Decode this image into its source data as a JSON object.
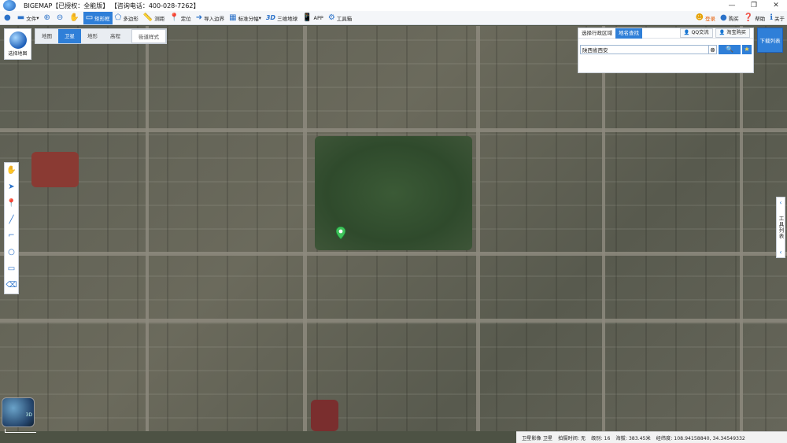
{
  "app": {
    "title": "BIGEMAP【已授权：全能版】 【咨询电话：400-028-7262】"
  },
  "window_controls": {
    "minimize": "—",
    "maximize": "❐",
    "close": "✕"
  },
  "toolbar": {
    "file": "文件",
    "rect_select": "矩形框",
    "polygon": "多边形",
    "measure": "测距",
    "locate": "定位",
    "import_boundary": "导入边界",
    "standard_tile": "标准分幅",
    "three_d": "3D",
    "three_d_globe": "三维地球",
    "app": "APP",
    "toolbox": "工具箱",
    "login": "登录",
    "purchase": "购买",
    "help": "帮助",
    "about": "关于"
  },
  "map_tabs": {
    "map": "地图",
    "satellite": "卫星",
    "terrain": "地形",
    "elevation": "高程",
    "street_style": "街道样式"
  },
  "choose_map": {
    "label": "选择地图"
  },
  "search": {
    "tab_admin": "选择行政区域",
    "tab_place": "地名查找",
    "qq": "QQ交流",
    "taobao": "淘宝购买",
    "value": "陕西省西安",
    "clear": "⊗",
    "search_icon": "🔍",
    "favorite": "★"
  },
  "download_list": {
    "label": "下载列表"
  },
  "right_tools": {
    "label": "工具列表",
    "up": "‹",
    "down": "‹"
  },
  "minimap": {
    "label": "3D"
  },
  "statusbar": {
    "layer": "卫星影像 卫星",
    "shot_time": "拍摄时间: 无",
    "level": "级别: 16",
    "altitude": "海拔: 383.45米",
    "coords": "经纬度: 108.94158840, 34.34549332"
  }
}
